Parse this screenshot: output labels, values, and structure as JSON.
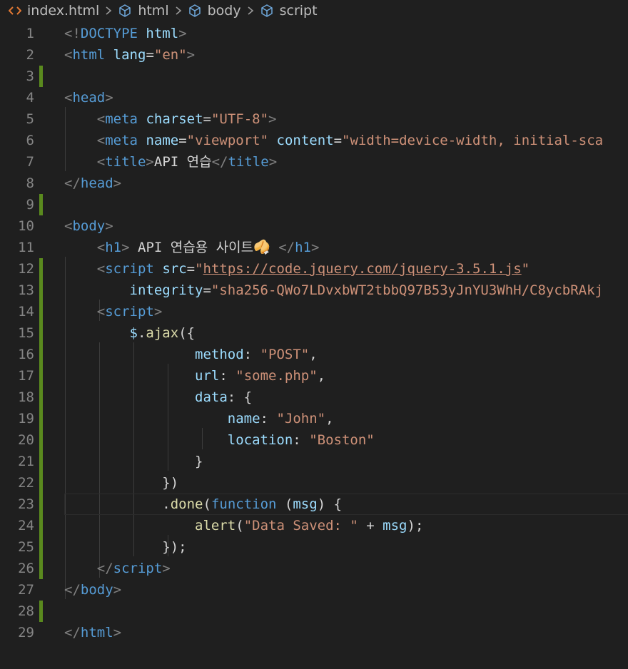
{
  "breadcrumb": {
    "items": [
      "index.html",
      "html",
      "body",
      "script"
    ]
  },
  "lines": [
    {
      "n": "1",
      "html": "<span class='p'>&lt;!</span><span class='t'>DOCTYPE</span><span class='w'> </span><span class='a'>html</span><span class='p'>&gt;</span>"
    },
    {
      "n": "2",
      "html": "<span class='p'>&lt;</span><span class='t'>html</span><span class='w'> </span><span class='a'>lang</span><span class='w'>=</span><span class='s'>\"en\"</span><span class='p'>&gt;</span>"
    },
    {
      "n": "3",
      "html": ""
    },
    {
      "n": "4",
      "html": "<span class='p'>&lt;</span><span class='t'>head</span><span class='p'>&gt;</span>"
    },
    {
      "n": "5",
      "html": "    <span class='p'>&lt;</span><span class='t'>meta</span><span class='w'> </span><span class='a'>charset</span><span class='w'>=</span><span class='s'>\"UTF-8\"</span><span class='p'>&gt;</span>"
    },
    {
      "n": "6",
      "html": "    <span class='p'>&lt;</span><span class='t'>meta</span><span class='w'> </span><span class='a'>name</span><span class='w'>=</span><span class='s'>\"viewport\"</span><span class='w'> </span><span class='a'>content</span><span class='w'>=</span><span class='s'>\"width=device-width, initial-sca</span>"
    },
    {
      "n": "7",
      "html": "    <span class='p'>&lt;</span><span class='t'>title</span><span class='p'>&gt;</span><span class='w'>API 연습</span><span class='p'>&lt;/</span><span class='t'>title</span><span class='p'>&gt;</span>"
    },
    {
      "n": "8",
      "html": "<span class='p'>&lt;/</span><span class='t'>head</span><span class='p'>&gt;</span>"
    },
    {
      "n": "9",
      "html": ""
    },
    {
      "n": "10",
      "html": "<span class='p'>&lt;</span><span class='t'>body</span><span class='p'>&gt;</span>"
    },
    {
      "n": "11",
      "html": "    <span class='p'>&lt;</span><span class='t'>h1</span><span class='p'>&gt;</span><span class='w'> API 연습용 사이트🥠 </span><span class='p'>&lt;/</span><span class='t'>h1</span><span class='p'>&gt;</span>"
    },
    {
      "n": "12",
      "html": "    <span class='p'>&lt;</span><span class='t'>script</span><span class='w'> </span><span class='a'>src</span><span class='w'>=</span><span class='s'>\"</span><span class='u'>https://code.jquery.com/jquery-3.5.1.js</span><span class='s'>\"</span>"
    },
    {
      "n": "13",
      "html": "        <span class='a'>integrity</span><span class='w'>=</span><span class='s'>\"sha256-QWo7LDvxbWT2tbbQ97B53yJnYU3WhH/C8ycbRAkj</span>"
    },
    {
      "n": "14",
      "html": "    <span class='p'>&lt;</span><span class='t'>script</span><span class='p'>&gt;</span>"
    },
    {
      "n": "15",
      "html": "        <span class='a'>$</span><span class='w'>.</span><span class='f'>ajax</span><span class='b'>({</span>"
    },
    {
      "n": "16",
      "html": "                <span class='a'>method</span><span class='w'>: </span><span class='s'>\"POST\"</span><span class='w'>,</span>"
    },
    {
      "n": "17",
      "html": "                <span class='a'>url</span><span class='w'>: </span><span class='s'>\"some.php\"</span><span class='w'>,</span>"
    },
    {
      "n": "18",
      "html": "                <span class='a'>data</span><span class='w'>: {</span>"
    },
    {
      "n": "19",
      "html": "                    <span class='a'>name</span><span class='w'>: </span><span class='s'>\"John\"</span><span class='w'>,</span>"
    },
    {
      "n": "20",
      "html": "                    <span class='a'>location</span><span class='w'>: </span><span class='s'>\"Boston\"</span>"
    },
    {
      "n": "21",
      "html": "                <span class='w'>}</span>"
    },
    {
      "n": "22",
      "html": "            <span class='b'>})</span>"
    },
    {
      "n": "23",
      "html": "            <span class='w'>.</span><span class='f'>done</span><span class='b'>(</span><span class='k'>function</span><span class='w'> (</span><span class='a'>msg</span><span class='w'>) {</span>"
    },
    {
      "n": "24",
      "html": "                <span class='f'>alert</span><span class='b'>(</span><span class='s'>\"Data Saved: \"</span><span class='w'> + </span><span class='a'>msg</span><span class='b'>)</span><span class='w'>;</span>"
    },
    {
      "n": "25",
      "html": "            <span class='b'>})</span><span class='w'>;</span>"
    },
    {
      "n": "26",
      "html": "    <span class='p'>&lt;/</span><span class='t'>script</span><span class='p'>&gt;</span>"
    },
    {
      "n": "27",
      "html": "<span class='p'>&lt;/</span><span class='t'>body</span><span class='p'>&gt;</span>"
    },
    {
      "n": "28",
      "html": ""
    },
    {
      "n": "29",
      "html": "<span class='p'>&lt;/</span><span class='t'>html</span><span class='p'>&gt;</span>"
    }
  ],
  "modified_lines": [
    3,
    9,
    12,
    13,
    14,
    15,
    16,
    17,
    18,
    19,
    20,
    21,
    22,
    23,
    24,
    25,
    26,
    28
  ],
  "current_line": 23,
  "colors": {
    "background": "#1f1f1f",
    "modified_gutter": "#5a8a1e",
    "tag": "#569cd6",
    "attribute": "#9cdcfe",
    "string": "#ce9178",
    "function": "#dcdcaa"
  }
}
